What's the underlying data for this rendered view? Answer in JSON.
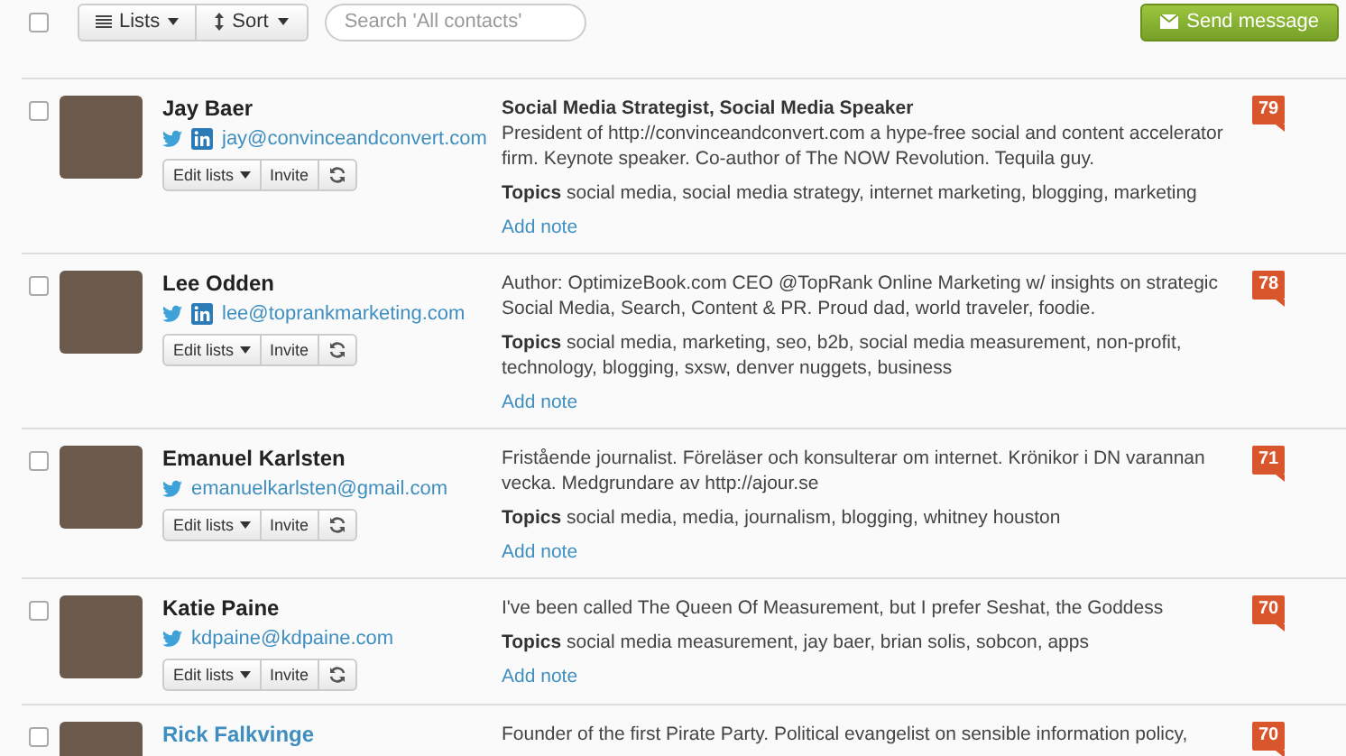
{
  "toolbar": {
    "select_all_checked": false,
    "lists_label": "Lists",
    "sort_label": "Sort",
    "search_placeholder": "Search 'All contacts'",
    "send_label": "Send message"
  },
  "contacts": [
    {
      "checked": false,
      "name": "Jay Baer",
      "name_linked": false,
      "twitter": true,
      "linkedin": true,
      "email": "jay@convinceandconvert.com",
      "edit_label": "Edit lists",
      "invite_label": "Invite",
      "title": "Social Media Strategist, Social Media Speaker",
      "bio": "President of http://convinceandconvert.com a hype-free social and content accelerator firm. Keynote speaker. Co-author of The NOW Revolution. Tequila guy.",
      "topics_label": "Topics",
      "topics": "social media, social media strategy, internet marketing, blogging, marketing",
      "note_label": "Add note",
      "score": "79"
    },
    {
      "checked": false,
      "name": "Lee Odden",
      "name_linked": false,
      "twitter": true,
      "linkedin": true,
      "email": "lee@toprankmarketing.com",
      "edit_label": "Edit lists",
      "invite_label": "Invite",
      "bio": "Author: OptimizeBook.com CEO @TopRank Online Marketing w/ insights on strategic Social Media, Search, Content & PR. Proud dad, world traveler, foodie.",
      "topics_label": "Topics",
      "topics": "social media, marketing, seo, b2b, social media measurement, non-profit, technology, blogging, sxsw, denver nuggets, business",
      "note_label": "Add note",
      "score": "78"
    },
    {
      "checked": false,
      "name": "Emanuel Karlsten",
      "name_linked": false,
      "twitter": true,
      "linkedin": false,
      "email": "emanuelkarlsten@gmail.com",
      "edit_label": "Edit lists",
      "invite_label": "Invite",
      "bio": "Fristående journalist. Föreläser och konsulterar om internet. Krönikor i DN varannan vecka. Medgrundare av http://ajour.se",
      "topics_label": "Topics",
      "topics": "social media, media, journalism, blogging, whitney houston",
      "note_label": "Add note",
      "score": "71"
    },
    {
      "checked": false,
      "name": "Katie Paine",
      "name_linked": false,
      "twitter": true,
      "linkedin": false,
      "email": "kdpaine@kdpaine.com",
      "edit_label": "Edit lists",
      "invite_label": "Invite",
      "bio": "I've been called The Queen Of Measurement, but I prefer Seshat, the Goddess",
      "topics_label": "Topics",
      "topics": "social media measurement, jay baer, brian solis, sobcon, apps",
      "note_label": "Add note",
      "score": "70"
    },
    {
      "checked": false,
      "name": "Rick Falkvinge",
      "name_linked": true,
      "twitter": false,
      "linkedin": false,
      "bio": "Founder of the first Pirate Party. Political evangelist on sensible information policy,",
      "score": "70"
    }
  ]
}
